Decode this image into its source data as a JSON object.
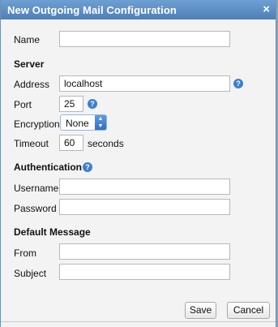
{
  "dialog": {
    "title": "New Outgoing Mail Configuration",
    "close_icon": "×"
  },
  "name_label": "Name",
  "name_value": "",
  "server": {
    "section": "Server",
    "address_label": "Address",
    "address_value": "localhost",
    "port_label": "Port",
    "port_value": "25",
    "encryption_label": "Encryption",
    "encryption_value": "None",
    "timeout_label": "Timeout",
    "timeout_value": "60",
    "timeout_unit": "seconds"
  },
  "auth": {
    "section": "Authentication",
    "username_label": "Username",
    "username_value": "",
    "password_label": "Password",
    "password_value": ""
  },
  "default_message": {
    "section": "Default Message",
    "from_label": "From",
    "from_value": "",
    "subject_label": "Subject",
    "subject_value": ""
  },
  "buttons": {
    "save": "Save",
    "cancel": "Cancel"
  },
  "icons": {
    "help": "?"
  },
  "colors": {
    "titlebar": "#5b8cc4",
    "help": "#3d7fd0"
  }
}
